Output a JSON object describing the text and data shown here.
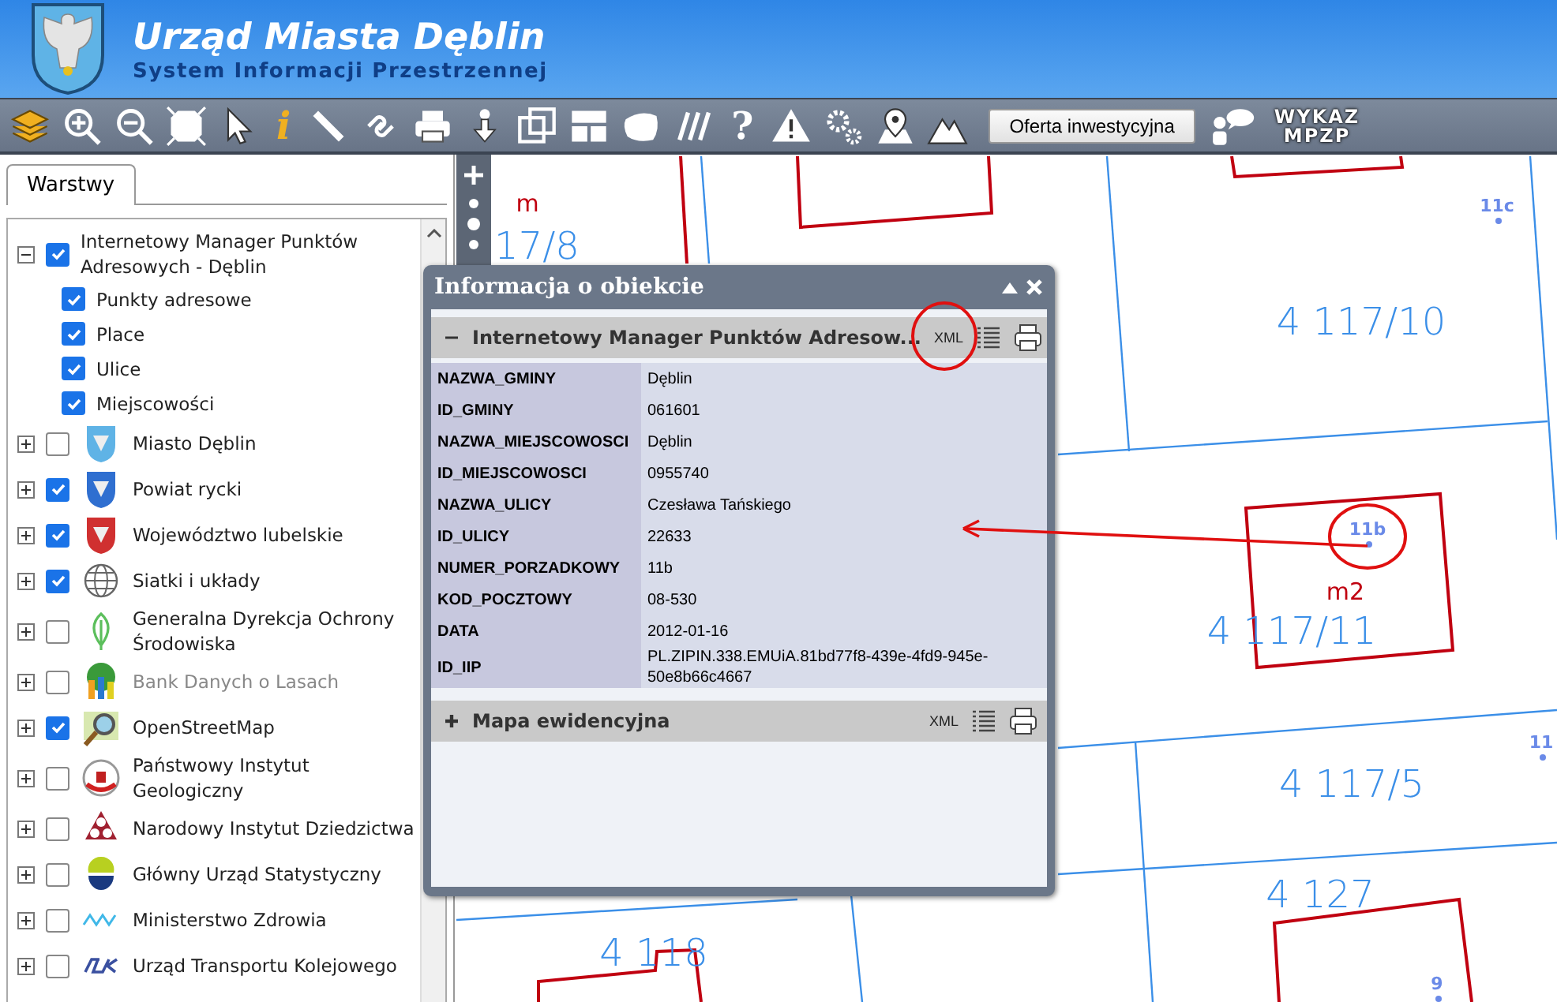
{
  "header": {
    "title": "Urząd Miasta Dęblin",
    "subtitle": "System Informacji Przestrzennej"
  },
  "toolbar": {
    "items": [
      {
        "kind": "layers"
      },
      {
        "kind": "zoom-in"
      },
      {
        "kind": "zoom-out"
      },
      {
        "kind": "extent"
      },
      {
        "kind": "pointer"
      },
      {
        "kind": "info",
        "label": "i"
      },
      {
        "kind": "ruler"
      },
      {
        "kind": "link"
      },
      {
        "kind": "print"
      },
      {
        "kind": "download"
      },
      {
        "kind": "windows"
      },
      {
        "kind": "layout"
      },
      {
        "kind": "shape"
      },
      {
        "kind": "hatch"
      },
      {
        "kind": "help",
        "label": "?"
      },
      {
        "kind": "warning"
      },
      {
        "kind": "gears"
      },
      {
        "kind": "map-pin"
      },
      {
        "kind": "mountains"
      }
    ],
    "button": "Oferta inwestycyjna",
    "wykaz": [
      "WYKAZ",
      "MPZP"
    ]
  },
  "sidebar": {
    "tab": "Warstwy",
    "tree": [
      {
        "label": "Internetowy Manager Punktów Adresowych - Dęblin",
        "checked": true,
        "expanded": true,
        "disabled": false,
        "children": [
          {
            "label": "Punkty adresowe",
            "checked": true
          },
          {
            "label": "Place",
            "checked": true
          },
          {
            "label": "Ulice",
            "checked": true
          },
          {
            "label": "Miejscowości",
            "checked": true
          }
        ]
      },
      {
        "label": "Miasto Dęblin",
        "checked": false,
        "expanded": false,
        "disabled": false
      },
      {
        "label": "Powiat rycki",
        "checked": true,
        "expanded": false,
        "disabled": false
      },
      {
        "label": "Województwo lubelskie",
        "checked": true,
        "expanded": false,
        "disabled": false
      },
      {
        "label": "Siatki i układy",
        "checked": true,
        "expanded": false,
        "disabled": false
      },
      {
        "label": "Generalna Dyrekcja Ochrony Środowiska",
        "checked": false,
        "expanded": false,
        "disabled": false
      },
      {
        "label": "Bank Danych o Lasach",
        "checked": false,
        "expanded": false,
        "disabled": true
      },
      {
        "label": "OpenStreetMap",
        "checked": true,
        "expanded": false,
        "disabled": false
      },
      {
        "label": "Państwowy Instytut Geologiczny",
        "checked": false,
        "expanded": false,
        "disabled": false
      },
      {
        "label": "Narodowy Instytut Dziedzictwa",
        "checked": false,
        "expanded": false,
        "disabled": false
      },
      {
        "label": "Główny Urząd Statystyczny",
        "checked": false,
        "expanded": false,
        "disabled": false
      },
      {
        "label": "Ministerstwo Zdrowia",
        "checked": false,
        "expanded": false,
        "disabled": false
      },
      {
        "label": "Urząd Transportu Kolejowego",
        "checked": false,
        "expanded": false,
        "disabled": false
      }
    ]
  },
  "map": {
    "labels": [
      {
        "kind": "building",
        "text": "m"
      },
      {
        "kind": "parcel",
        "text": "17/8"
      },
      {
        "kind": "parcel",
        "text": "4 117/10"
      },
      {
        "kind": "address",
        "text": "11c"
      },
      {
        "kind": "address",
        "text": "11b"
      },
      {
        "kind": "building",
        "text": "m2"
      },
      {
        "kind": "parcel",
        "text": "4 117/11"
      },
      {
        "kind": "parcel",
        "text": "4 117/5"
      },
      {
        "kind": "address",
        "text": "11"
      },
      {
        "kind": "parcel",
        "text": "4 127"
      },
      {
        "kind": "parcel",
        "text": "4 118"
      },
      {
        "kind": "address",
        "text": "9"
      }
    ]
  },
  "popup": {
    "title": "Informacja o obiekcie",
    "sections": [
      {
        "title": "Internetowy Manager Punktów Adresow...",
        "expanded": true,
        "xml": "XML",
        "rows": [
          [
            "NAZWA_GMINY",
            "Dęblin"
          ],
          [
            "ID_GMINY",
            "061601"
          ],
          [
            "NAZWA_MIEJSCOWOSCI",
            "Dęblin"
          ],
          [
            "ID_MIEJSCOWOSCI",
            "0955740"
          ],
          [
            "NAZWA_ULICY",
            "Czesława Tańskiego"
          ],
          [
            "ID_ULICY",
            "22633"
          ],
          [
            "NUMER_PORZADKOWY",
            "11b"
          ],
          [
            "KOD_POCZTOWY",
            "08-530"
          ],
          [
            "DATA",
            "2012-01-16"
          ],
          [
            "ID_IIP",
            "PL.ZIPIN.338.EMUiA.81bd77f8-439e-4fd9-945e-50e8b66c4667"
          ]
        ]
      },
      {
        "title": "Mapa ewidencyjna",
        "expanded": false,
        "xml": "XML"
      }
    ]
  }
}
